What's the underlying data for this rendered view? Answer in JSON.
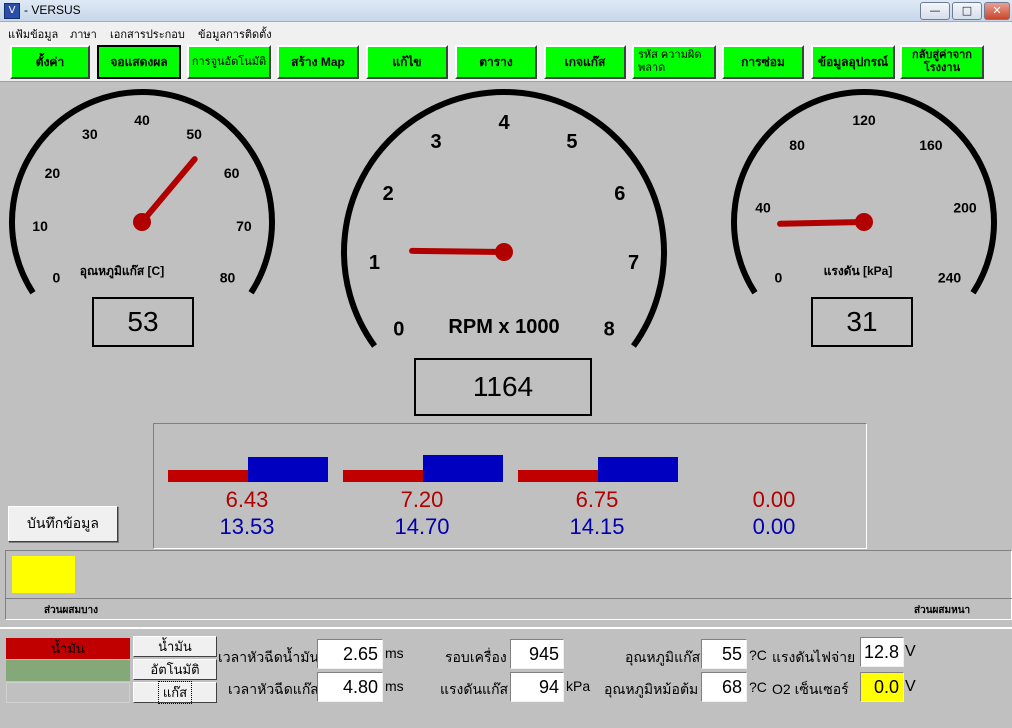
{
  "window": {
    "title": "- VERSUS",
    "app_icon": "V",
    "minimize": "—",
    "maximize": "□",
    "close": "✕"
  },
  "menu": [
    "แฟ้มข้อมูล",
    "ภาษา",
    "เอกสารประกอบ",
    "ข้อมูลการติดตั้ง"
  ],
  "toolbar": [
    "ตั้งค่า",
    "จอแสดงผล",
    "การจูนอัตโนมัติ",
    "สร้าง Map",
    "แก้ไข",
    "ตาราง",
    "เกจแก๊ส",
    "รหัส ความผิดพลาด",
    "การซ่อม",
    "ข้อมูลอุปกรณ์",
    "กลับสู่ค่าจากโรงงาน"
  ],
  "gauges": {
    "temp": {
      "label": "อุณหภูมิแก๊ส [C]",
      "ticks": [
        "0",
        "10",
        "20",
        "30",
        "40",
        "50",
        "60",
        "70",
        "80"
      ],
      "value": 53,
      "readout": "53"
    },
    "rpm": {
      "label": "RPM x 1000",
      "ticks": [
        "0",
        "1",
        "2",
        "3",
        "4",
        "5",
        "6",
        "7",
        "8"
      ],
      "value": 1.164,
      "readout": "1164"
    },
    "pressure": {
      "label": "แรงดัน [kPa]",
      "ticks": [
        "0",
        "40",
        "80",
        "120",
        "160",
        "200",
        "240"
      ],
      "value": 31,
      "readout": "31"
    }
  },
  "bars": [
    {
      "red": "6.43",
      "blue": "13.53"
    },
    {
      "red": "7.20",
      "blue": "14.70"
    },
    {
      "red": "6.75",
      "blue": "14.15"
    },
    {
      "red": "0.00",
      "blue": "0.00"
    }
  ],
  "save_button": "บันทึกข้อมูล",
  "mixture": {
    "lean_label": "ส่วนผสมบาง",
    "rich_label": "ส่วนผสมหนา"
  },
  "fuel": {
    "oil_label": "น้ำมัน",
    "btn_oil": "น้ำมัน",
    "btn_auto": "อัตโนมัติ",
    "btn_gas": "แก๊ส"
  },
  "readings": {
    "oil_inj_label": "เวลาหัวฉีดน้ำมัน",
    "oil_inj_value": "2.65",
    "oil_inj_unit": "ms",
    "gas_inj_label": "เวลาหัวฉีดแก๊ส",
    "gas_inj_value": "4.80",
    "gas_inj_unit": "ms",
    "rpm_label": "รอบเครื่อง",
    "rpm_value": "945",
    "gas_press_label": "แรงดันแก๊ส",
    "gas_press_value": "94",
    "gas_press_unit": "kPa",
    "gas_temp_label": "อุณหภูมิแก๊ส",
    "gas_temp_value": "55",
    "gas_temp_unit": "?C",
    "coolant_label": "อุณหภูมิหม้อต้ม",
    "coolant_value": "68",
    "coolant_unit": "?C",
    "supply_label": "แรงดันไฟจ่าย",
    "supply_value": "12.8",
    "supply_unit": "V",
    "o2_label": "O2 เซ็นเซอร์",
    "o2_value": "0.0",
    "o2_unit": "V"
  },
  "colors": {
    "needle": "#b00000",
    "bar_red": "#c00000",
    "bar_blue": "#0000c0",
    "button_green": "#00ff00",
    "indicator_yellow": "#ffff00"
  }
}
